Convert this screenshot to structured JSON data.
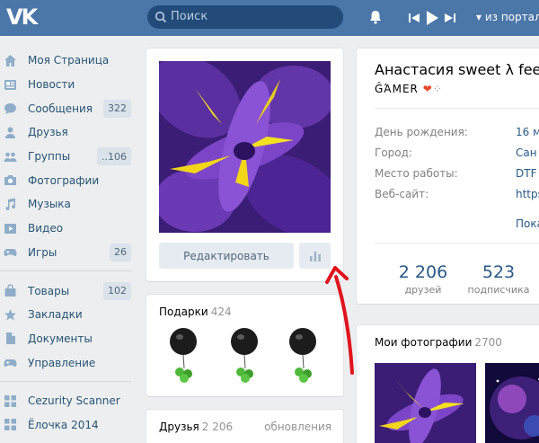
{
  "header": {
    "logo": "VK",
    "search_placeholder": "Поиск",
    "now_playing": "из портал Т"
  },
  "sidebar": {
    "items": [
      {
        "label": "Моя Страница",
        "icon": "home-icon"
      },
      {
        "label": "Новости",
        "icon": "news-icon"
      },
      {
        "label": "Сообщения",
        "icon": "messages-icon",
        "count": "322"
      },
      {
        "label": "Друзья",
        "icon": "friends-icon"
      },
      {
        "label": "Группы",
        "icon": "groups-icon",
        "count": "..106"
      },
      {
        "label": "Фотографии",
        "icon": "camera-icon"
      },
      {
        "label": "Музыка",
        "icon": "music-icon"
      },
      {
        "label": "Видео",
        "icon": "video-icon"
      },
      {
        "label": "Игры",
        "icon": "gamepad-icon",
        "count": "26"
      },
      {
        "label": "Товары",
        "icon": "bag-icon",
        "count": "102"
      },
      {
        "label": "Закладки",
        "icon": "star-icon"
      },
      {
        "label": "Документы",
        "icon": "document-icon"
      },
      {
        "label": "Управление",
        "icon": "gamepad-icon"
      },
      {
        "label": "Cezurity Scanner",
        "icon": "app-icon"
      },
      {
        "label": "Ёлочка 2014",
        "icon": "app-icon"
      }
    ]
  },
  "avatar_card": {
    "edit_label": "Редактировать"
  },
  "gifts": {
    "title": "Подарки",
    "count": "424"
  },
  "friends": {
    "title": "Друзья",
    "count": "2 206",
    "updates": "обновления"
  },
  "profile": {
    "name": "Анастасия sweet λ fee",
    "status": "ĜΆΜΕR",
    "info": [
      {
        "label": "День рождения:",
        "value": "16 м"
      },
      {
        "label": "Город:",
        "value": "Сан"
      },
      {
        "label": "Место работы:",
        "value": "DTF"
      },
      {
        "label": "Веб-сайт:",
        "value": "https"
      }
    ],
    "more": "Пока",
    "counters": [
      {
        "num": "2 206",
        "label": "друзей"
      },
      {
        "num": "523",
        "label": "подписчика"
      }
    ]
  },
  "photos": {
    "title": "Мои фотографии",
    "count": "2700"
  },
  "colors": {
    "header": "#4a76a8",
    "link": "#2a5885",
    "background": "#edeef0",
    "annotation_arrow": "#e0141e"
  }
}
